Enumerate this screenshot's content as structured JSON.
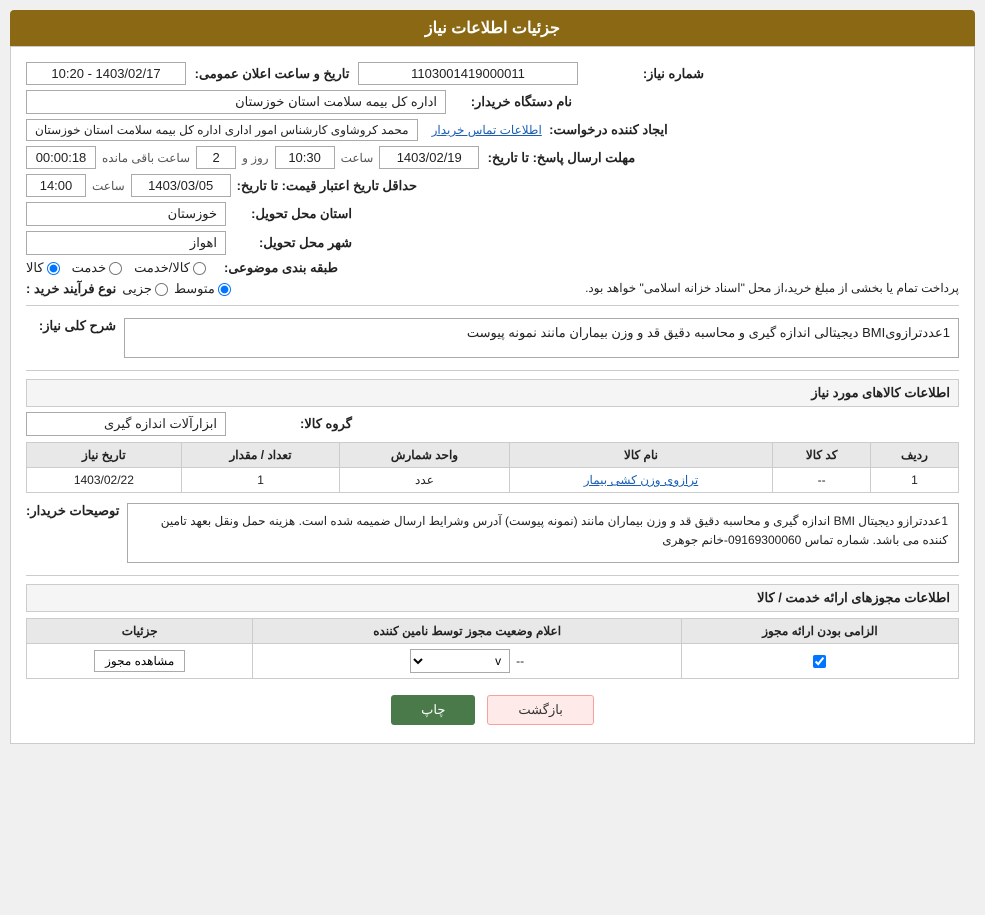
{
  "header": {
    "title": "جزئیات اطلاعات نیاز"
  },
  "form": {
    "need_number_label": "شماره نیاز:",
    "need_number_value": "1103001419000011",
    "announce_date_label": "تاریخ و ساعت اعلان عمومی:",
    "announce_date_value": "1403/02/17 - 10:20",
    "org_name_label": "نام دستگاه خریدار:",
    "org_name_value": "اداره کل بیمه سلامت استان خوزستان",
    "creator_label": "ایجاد کننده درخواست:",
    "creator_value": "محمد کروشاوی کارشناس امور اداری اداره کل بیمه سلامت استان خوزستان",
    "contact_link": "اطلاعات تماس خریدار",
    "response_deadline_label": "مهلت ارسال پاسخ: تا تاریخ:",
    "response_date_value": "1403/02/19",
    "response_time_label": "ساعت",
    "response_time_value": "10:30",
    "response_day_label": "روز و",
    "response_day_value": "2",
    "response_remaining_label": "ساعت باقی مانده",
    "response_remaining_value": "00:00:18",
    "price_validity_label": "حداقل تاریخ اعتبار قیمت: تا تاریخ:",
    "price_validity_date": "1403/03/05",
    "price_validity_time_label": "ساعت",
    "price_validity_time": "14:00",
    "province_label": "استان محل تحویل:",
    "province_value": "خوزستان",
    "city_label": "شهر محل تحویل:",
    "city_value": "اهواز",
    "product_type_label": "طبقه بندی موضوعی:",
    "product_type_options": [
      "کالا",
      "خدمت",
      "کالا/خدمت"
    ],
    "product_type_selected": "کالا",
    "process_type_label": "نوع فرآیند خرید :",
    "process_type_options": [
      "جزیی",
      "متوسط"
    ],
    "process_type_selected": "متوسط",
    "process_note": "پرداخت تمام یا بخشی از مبلغ خرید،از محل \"اسناد خزانه اسلامی\" خواهد بود.",
    "need_description_label": "شرح کلی نیاز:",
    "need_description_value": "1عددترازویBMI دیجیتالی اندازه گیری  و محاسبه دقیق قد و وزن  بیماران مانند نمونه پیوست",
    "goods_section_label": "اطلاعات کالاهای مورد نیاز",
    "goods_group_label": "گروه کالا:",
    "goods_group_value": "ابزارآلات اندازه گیری",
    "table": {
      "columns": [
        "ردیف",
        "کد کالا",
        "نام کالا",
        "واحد شمارش",
        "تعداد / مقدار",
        "تاریخ نیاز"
      ],
      "rows": [
        {
          "row": "1",
          "code": "--",
          "name": "ترازوی وزن کشی بیمار",
          "unit": "عدد",
          "quantity": "1",
          "date": "1403/02/22"
        }
      ]
    },
    "buyer_notes_label": "توصیحات خریدار:",
    "buyer_notes_value": "1عددترازو دیجیتال BMI اندازه گیری و محاسبه  دقیق قد و وزن بیماران مانند (نمونه پیوست) آدرس وشرایط ارسال ضمیمه شده است.  هزینه حمل ونقل بعهد تامین کننده می باشد. شماره تماس 09169300060-خانم جوهری",
    "license_section_label": "اطلاعات مجوزهای ارائه خدمت / کالا",
    "license_table": {
      "columns": [
        "الزامی بودن ارائه مجوز",
        "اعلام وضعیت مجوز توسط نامین کننده",
        "جزئیات"
      ],
      "rows": [
        {
          "required": true,
          "status": "--",
          "details_btn": "مشاهده مجوز"
        }
      ]
    }
  },
  "buttons": {
    "print": "چاپ",
    "back": "بازگشت"
  }
}
